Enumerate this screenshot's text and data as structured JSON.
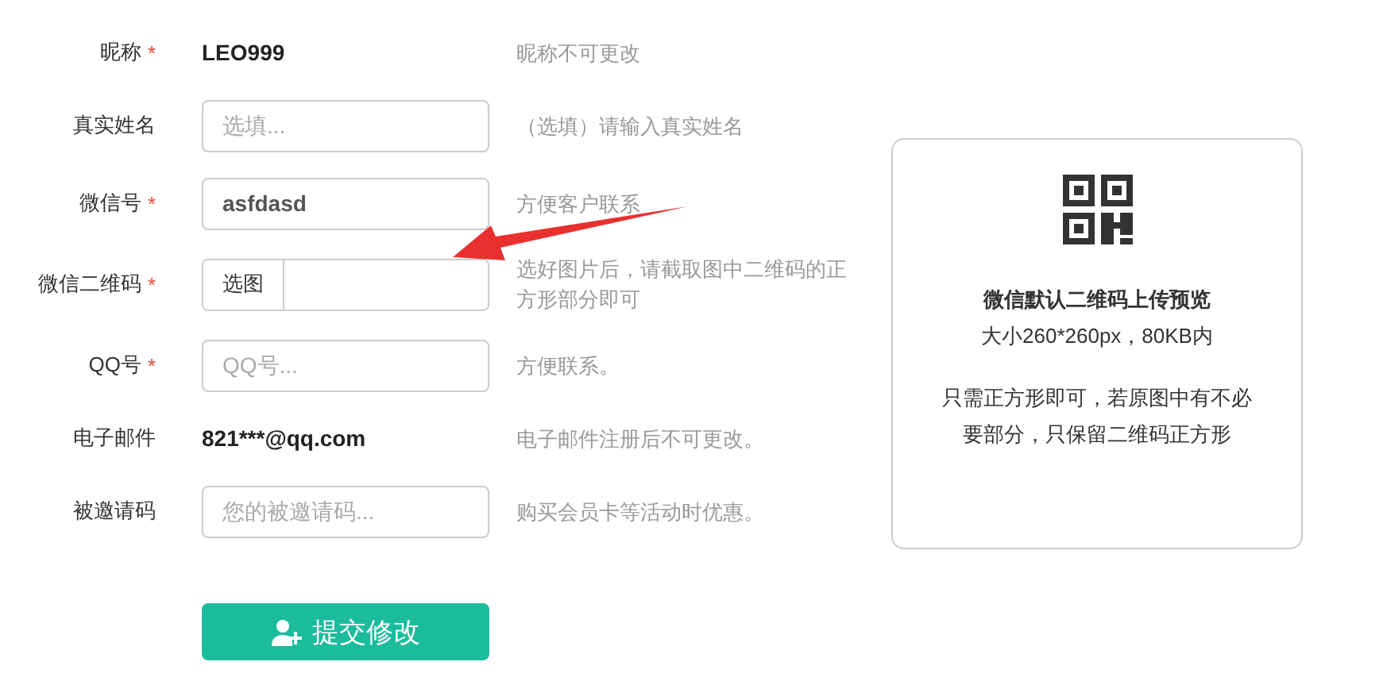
{
  "form": {
    "fields": [
      {
        "kind": "text",
        "label": "昵称",
        "required_mark": "*",
        "value": "LEO999",
        "help": "昵称不可更改"
      },
      {
        "kind": "input",
        "label": "真实姓名",
        "placeholder": "选填...",
        "help": "（选填）请输入真实姓名"
      },
      {
        "kind": "input",
        "label": "微信号",
        "required_mark": "*",
        "value": "asfdasd",
        "help": "方便客户联系"
      },
      {
        "kind": "file",
        "label": "微信二维码",
        "required_mark": "*",
        "button": "选图",
        "help": "选好图片后，请截取图中二维码的正方形部分即可"
      },
      {
        "kind": "input",
        "label": "QQ号",
        "required_mark": "*",
        "placeholder": "QQ号...",
        "help": "方便联系。"
      },
      {
        "kind": "text",
        "label": "电子邮件",
        "value": "821***@qq.com",
        "help": "电子邮件注册后不可更改。"
      },
      {
        "kind": "input",
        "label": "被邀请码",
        "placeholder": "您的被邀请码...",
        "help": "购买会员卡等活动时优惠。"
      }
    ],
    "submit": "提交修改"
  },
  "preview": {
    "title": "微信默认二维码上传预览",
    "size_note": "大小260*260px，80KB内",
    "tip": "只需正方形即可，若原图中有不必要部分，只保留二维码正方形"
  }
}
